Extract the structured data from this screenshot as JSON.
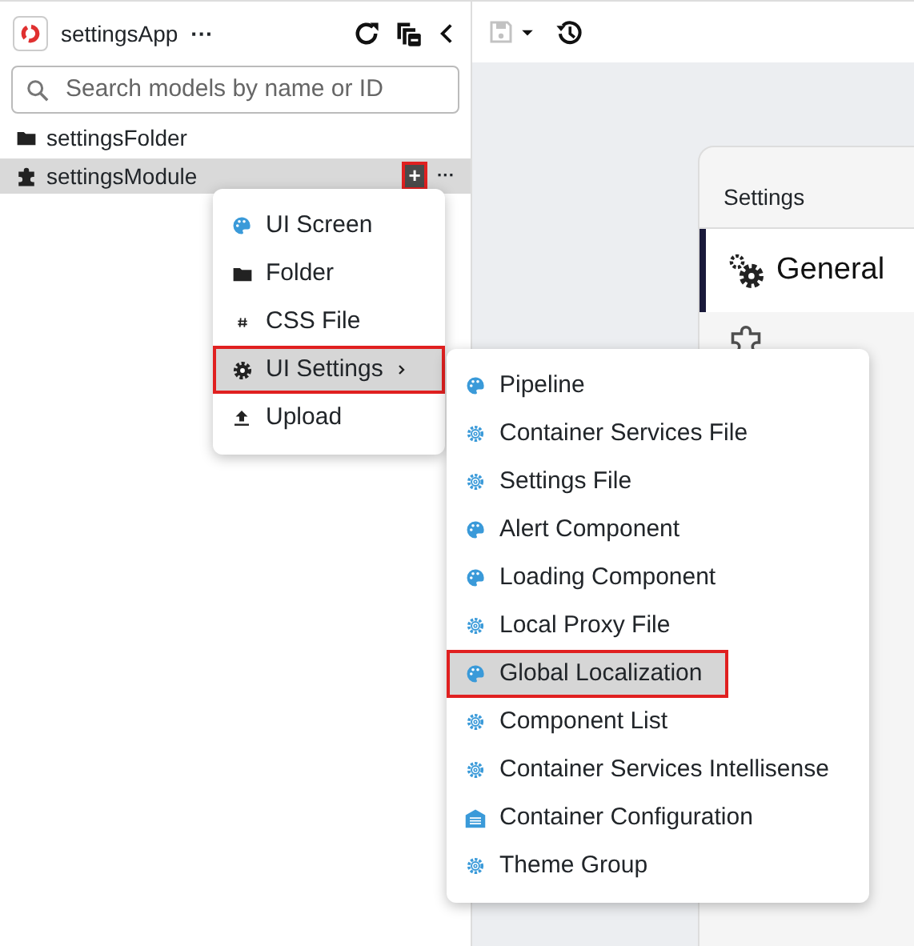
{
  "app": {
    "title": "settingsApp",
    "more": "···"
  },
  "search": {
    "placeholder": "Search models by name or ID"
  },
  "tree": [
    {
      "label": "settingsFolder",
      "kind": "folder",
      "selected": false
    },
    {
      "label": "settingsModule",
      "kind": "module",
      "selected": true,
      "add": "+",
      "more": "···",
      "outlined": true
    }
  ],
  "toolbar": {
    "save_disabled": true
  },
  "settings_card": {
    "title": "Settings",
    "items": [
      {
        "label": "General",
        "kind": "gears",
        "selected": true
      },
      {
        "kind": "puzzle",
        "selected": false
      }
    ]
  },
  "menu": [
    {
      "label": "UI Screen",
      "kind": "palette",
      "selected": false,
      "outlined": false,
      "submenu": false
    },
    {
      "label": "Folder",
      "kind": "folder",
      "selected": false,
      "outlined": false,
      "submenu": false
    },
    {
      "label": "CSS File",
      "kind": "hash",
      "selected": false,
      "outlined": false,
      "submenu": false
    },
    {
      "label": "UI Settings",
      "kind": "gear",
      "selected": true,
      "outlined": true,
      "submenu": true
    },
    {
      "label": "Upload",
      "kind": "upload",
      "selected": false,
      "outlined": false,
      "submenu": false
    }
  ],
  "submenu": [
    {
      "label": "Pipeline",
      "kind": "palette",
      "selected": false,
      "outlined": false
    },
    {
      "label": "Container Services File",
      "kind": "cog",
      "selected": false,
      "outlined": false
    },
    {
      "label": "Settings File",
      "kind": "cog",
      "selected": false,
      "outlined": false
    },
    {
      "label": "Alert Component",
      "kind": "palette",
      "selected": false,
      "outlined": false
    },
    {
      "label": "Loading Component",
      "kind": "palette",
      "selected": false,
      "outlined": false
    },
    {
      "label": "Local Proxy File",
      "kind": "cog",
      "selected": false,
      "outlined": false
    },
    {
      "label": "Global Localization",
      "kind": "palette",
      "selected": true,
      "outlined": true
    },
    {
      "label": "Component List",
      "kind": "cog",
      "selected": false,
      "outlined": false
    },
    {
      "label": "Container Services Intellisense",
      "kind": "cog",
      "selected": false,
      "outlined": false
    },
    {
      "label": "Container Configuration",
      "kind": "container",
      "selected": false,
      "outlined": false
    },
    {
      "label": "Theme Group",
      "kind": "cog",
      "selected": false,
      "outlined": false
    }
  ]
}
